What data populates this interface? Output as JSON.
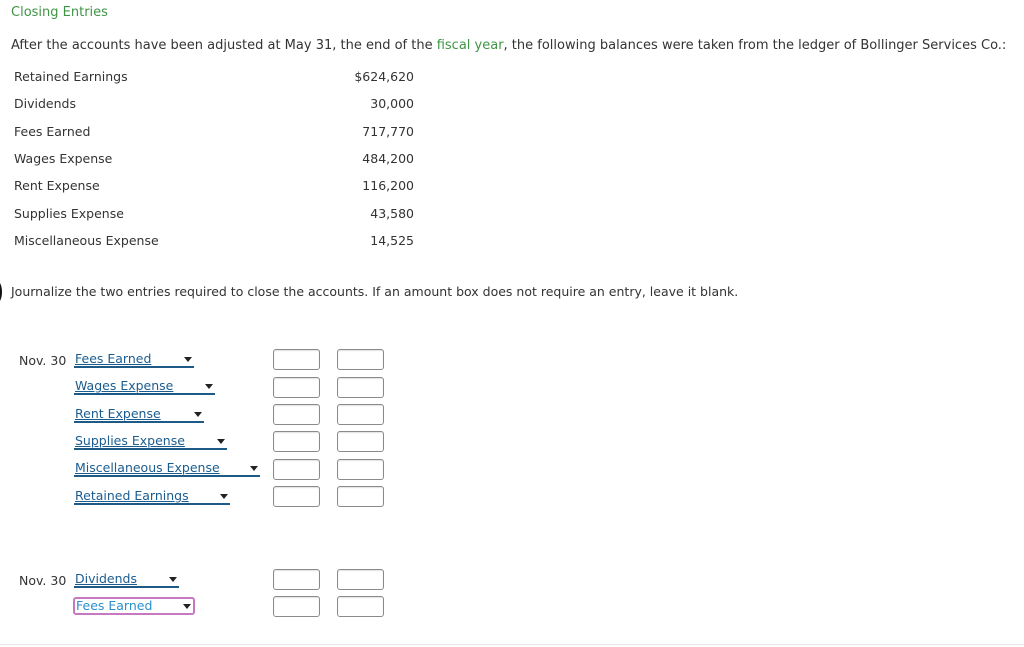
{
  "header": {
    "title": "Closing Entries"
  },
  "intro": {
    "before": "After the accounts have been adjusted at May 31, the end of the ",
    "link": "fiscal year",
    "after": ", the following balances were taken from the ledger of Bollinger Services Co.:"
  },
  "balances": [
    {
      "name": "Retained Earnings",
      "amount": "$624,620"
    },
    {
      "name": "Dividends",
      "amount": "30,000"
    },
    {
      "name": "Fees Earned",
      "amount": "717,770"
    },
    {
      "name": "Wages Expense",
      "amount": "484,200"
    },
    {
      "name": "Rent Expense",
      "amount": "116,200"
    },
    {
      "name": "Supplies Expense",
      "amount": "43,580"
    },
    {
      "name": "Miscellaneous Expense",
      "amount": "14,525"
    }
  ],
  "instructions": "Journalize the two entries required to close the accounts. If an amount box does not require an entry, leave it blank.",
  "entries": [
    {
      "date": "Nov. 30",
      "lines": [
        {
          "account": "Fees Earned",
          "debit": "",
          "credit": ""
        },
        {
          "account": "Wages Expense",
          "debit": "",
          "credit": ""
        },
        {
          "account": "Rent Expense",
          "debit": "",
          "credit": ""
        },
        {
          "account": "Supplies Expense",
          "debit": "",
          "credit": ""
        },
        {
          "account": "Miscellaneous Expense",
          "debit": "",
          "credit": ""
        },
        {
          "account": "Retained Earnings",
          "debit": "",
          "credit": ""
        }
      ]
    },
    {
      "date": "Nov. 30",
      "lines": [
        {
          "account": "Dividends",
          "debit": "",
          "credit": ""
        },
        {
          "account": "Fees Earned",
          "debit": "",
          "credit": ""
        }
      ]
    }
  ],
  "colors": {
    "accent_green": "#3f9445",
    "select_text": "#1b5c8f",
    "focus_border": "#c678c0"
  }
}
